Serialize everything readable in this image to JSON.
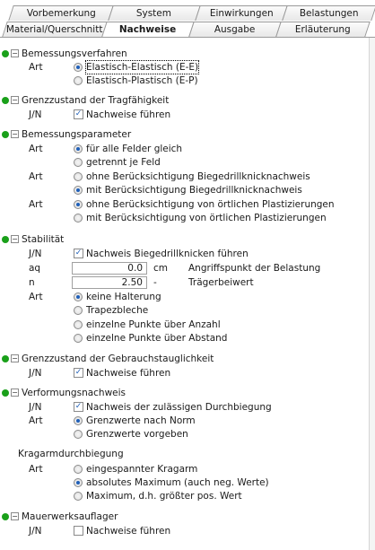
{
  "tabs_row1": [
    "Vorbemerkung",
    "System",
    "Einwirkungen",
    "Belastungen"
  ],
  "tabs_row2": [
    "Material/Querschnitt",
    "Nachweise",
    "Ausgabe",
    "Erläuterung"
  ],
  "active_tab": "Nachweise",
  "bemessungsverfahren": {
    "title": "Bemessungsverfahren",
    "art_label": "Art",
    "options": [
      "Elastisch-Elastisch (E-E)",
      "Elastisch-Plastisch (E-P)"
    ],
    "selected": 0
  },
  "tragfaehigkeit": {
    "title": "Grenzzustand der Tragfähigkeit",
    "jn_label": "J/N",
    "checkbox_label": "Nachweise führen",
    "checked": true
  },
  "bemessungsparameter": {
    "title": "Bemessungsparameter",
    "art_label": "Art",
    "group1": [
      "für alle Felder gleich",
      "getrennt je Feld"
    ],
    "group2": [
      "ohne Berücksichtigung Biegedrillknicknachweis",
      "mit Berücksichtigung Biegedrillknicknachweis"
    ],
    "group3": [
      "ohne Berücksichtigung von örtlichen Plastizierungen",
      "mit Berücksichtigung von örtlichen Plastizierungen"
    ]
  },
  "stabilitaet": {
    "title": "Stabilität",
    "jn_label": "J/N",
    "checkbox_label": "Nachweis Biegedrillknicken führen",
    "aq_label": "aq",
    "aq_value": "0.0",
    "aq_unit": "cm",
    "aq_desc": "Angriffspunkt der Belastung",
    "n_label": "n",
    "n_value": "2.50",
    "n_unit": "-",
    "n_desc": "Trägerbeiwert",
    "art_label": "Art",
    "options": [
      "keine Halterung",
      "Trapezbleche",
      "einzelne Punkte über Anzahl",
      "einzelne Punkte über Abstand"
    ]
  },
  "gebrauchstauglichkeit": {
    "title": "Grenzzustand der Gebrauchstauglichkeit",
    "jn_label": "J/N",
    "checkbox_label": "Nachweise führen"
  },
  "verformung": {
    "title": "Verformungsnachweis",
    "jn_label": "J/N",
    "checkbox_label": "Nachweis der zulässigen Durchbiegung",
    "art_label": "Art",
    "options": [
      "Grenzwerte nach Norm",
      "Grenzwerte vorgeben"
    ],
    "krag_title": "Kragarmdurchbiegung",
    "krag_art_label": "Art",
    "krag_options": [
      "eingespannter Kragarm",
      "absolutes Maximum (auch neg. Werte)",
      "Maximum, d.h. größter pos. Wert"
    ]
  },
  "mauerwerk": {
    "title": "Mauerwerksauflager",
    "jn_label": "J/N",
    "checkbox_label": "Nachweise führen"
  },
  "colors": {
    "section_dot": "#1aa01a",
    "radio_fill": "#1f5fb8"
  }
}
